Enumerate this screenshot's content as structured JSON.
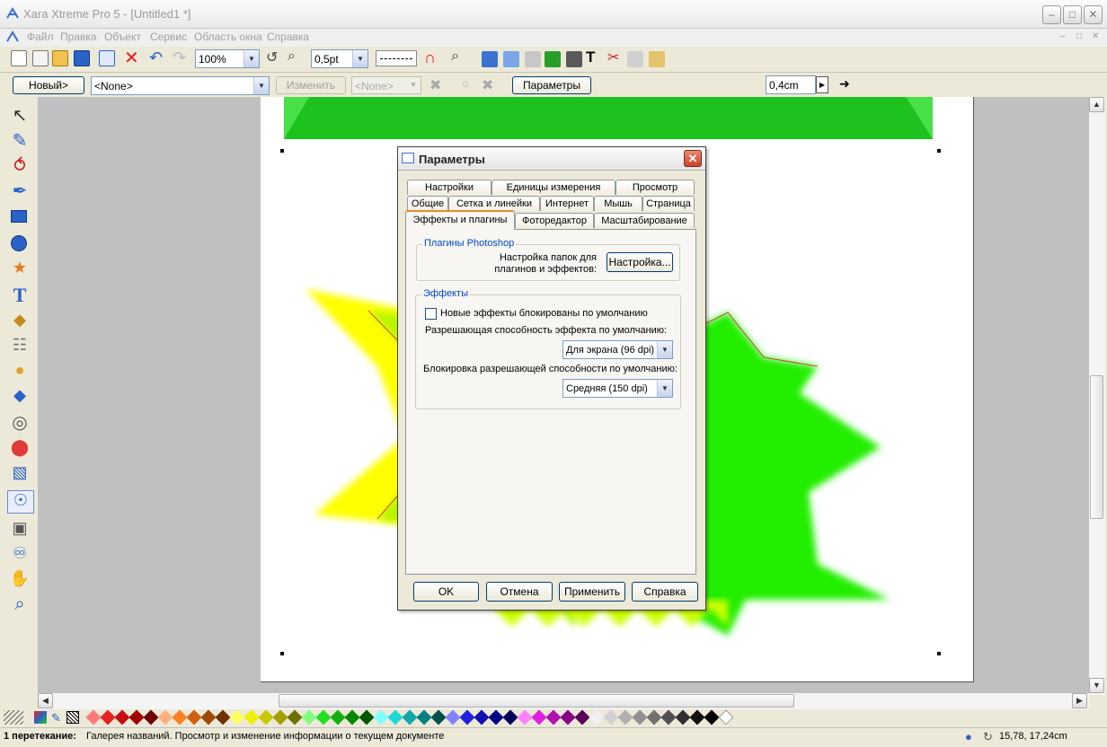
{
  "window": {
    "title": "Xara Xtreme Pro 5 - [Untitled1 *]"
  },
  "menu": [
    "Файл",
    "Правка",
    "Объект",
    "Сервис",
    "Область окна",
    "Справка"
  ],
  "toolbar1": {
    "zoom": "100%",
    "line_width": "0,5pt"
  },
  "toolbar2": {
    "new_button": "Новый>",
    "style_combo": "<None>",
    "change_button": "Изменить",
    "style_combo2": "<None>",
    "options_button": "Параметры",
    "size_value": "0,4cm"
  },
  "dialog": {
    "title": "Параметры",
    "tabs_row1": [
      "Настройки",
      "Единицы измерения",
      "Просмотр"
    ],
    "tabs_row2": [
      "Общие",
      "Сетка и линейки",
      "Интернет",
      "Мышь",
      "Страница"
    ],
    "tabs_row3": [
      "Эффекты и плагины",
      "Фоторедактор",
      "Масштабирование"
    ],
    "active_tab": "Эффекты и плагины",
    "photoshop_group": {
      "title": "Плагины Photoshop",
      "label_line1": "Настройка папок для",
      "label_line2": "плагинов и эффектов:",
      "setup_button": "Настройка..."
    },
    "effects_group": {
      "title": "Эффекты",
      "checkbox_label": "Новые эффекты блокированы по умолчанию",
      "checkbox_checked": false,
      "resolution_label": "Разрешающая способность эффекта по умолчанию:",
      "resolution_value": "Для экрана (96 dpi)",
      "lock_label": "Блокировка разрешающей способности по умолчанию:",
      "lock_value": "Средняя (150 dpi)"
    },
    "buttons": {
      "ok": "OK",
      "cancel": "Отмена",
      "apply": "Применить",
      "help": "Справка"
    }
  },
  "status": {
    "bold": "1 перетекание:",
    "text": "Галерея названий. Просмотр и изменение информации о текущем документе",
    "coords": "15,78, 17,24cm"
  },
  "colors": {
    "accent_green": "#1ec21e",
    "star_yellow": "#ffff00",
    "star_green": "#22ee00",
    "dialog_close": "#d74a2f"
  }
}
